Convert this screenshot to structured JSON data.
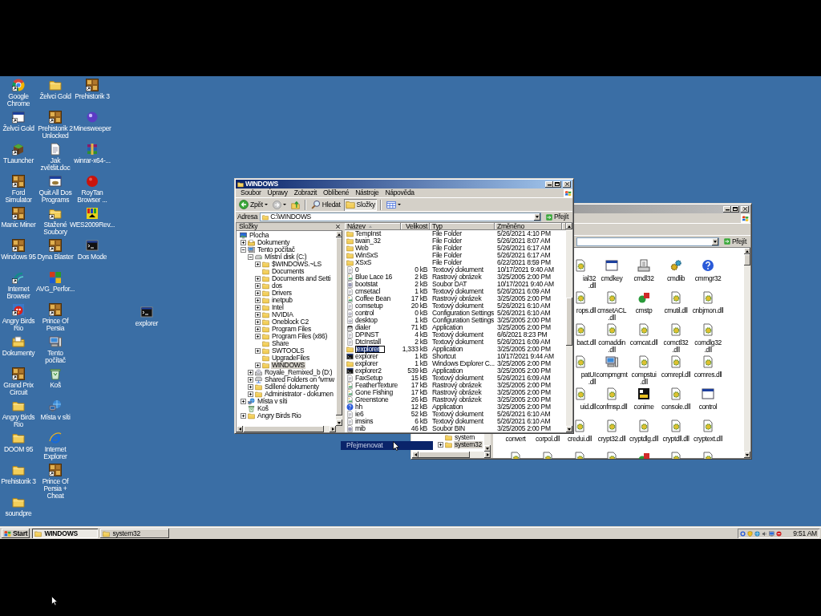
{
  "desktop": {
    "icon_rows": [
      [
        {
          "label": "Google Chrome",
          "kind": "chrome",
          "shortcut": true
        },
        {
          "label": "Želvci Gold",
          "kind": "folder",
          "shortcut": false
        },
        {
          "label": "Prehistorik 3",
          "kind": "tile",
          "shortcut": true
        }
      ],
      [
        {
          "label": "Želvci Gold",
          "kind": "window",
          "shortcut": true
        },
        {
          "label": "Prehistorik 2 Unlocked",
          "kind": "tile",
          "shortcut": true
        },
        {
          "label": "Minesweeper",
          "kind": "orb",
          "shortcut": false
        }
      ],
      [
        {
          "label": "TLauncher",
          "kind": "block",
          "shortcut": true
        },
        {
          "label": "Jak zvětšit.doc",
          "kind": "document",
          "shortcut": false
        },
        {
          "label": "winrar-x64-...",
          "kind": "books",
          "shortcut": false
        }
      ],
      [
        {
          "label": "Ford Simulator",
          "kind": "tile",
          "shortcut": true
        },
        {
          "label": "Quit All Dos Programs",
          "kind": "dos",
          "shortcut": false
        },
        {
          "label": "RoyTan Browser ...",
          "kind": "ball",
          "shortcut": false
        }
      ],
      [
        {
          "label": "Manic Miner",
          "kind": "tile",
          "shortcut": true
        },
        {
          "label": "Stažené Soubory",
          "kind": "folder",
          "shortcut": true
        },
        {
          "label": "WES2009Rev...",
          "kind": "grid",
          "shortcut": false
        }
      ],
      [
        {
          "label": "Windows 95",
          "kind": "tile",
          "shortcut": true
        },
        {
          "label": "Dyna Blaster",
          "kind": "tile",
          "shortcut": true
        },
        {
          "label": "Dos Mode",
          "kind": "console",
          "shortcut": false
        }
      ],
      [
        {
          "label": "Internet Browser",
          "kind": "swirl",
          "shortcut": true
        },
        {
          "label": "AVG_Perfor...",
          "kind": "squares",
          "shortcut": false
        }
      ],
      [
        {
          "label": "Angry Birds Rio",
          "kind": "bird",
          "shortcut": true
        },
        {
          "label": "Prince Of Persia",
          "kind": "tile",
          "shortcut": true
        }
      ],
      [
        {
          "label": "Dokumenty",
          "kind": "docfolder",
          "shortcut": false
        },
        {
          "label": "Tento počítač",
          "kind": "computer",
          "shortcut": false
        }
      ],
      [
        {
          "label": "Grand Prix Circuit",
          "kind": "tile",
          "shortcut": true
        },
        {
          "label": "Koš",
          "kind": "recycle",
          "shortcut": false
        }
      ],
      [
        {
          "label": "Angry Birds Rio",
          "kind": "folder",
          "shortcut": false
        },
        {
          "label": "Místa v síti",
          "kind": "network",
          "shortcut": false
        }
      ],
      [
        {
          "label": "DOOM 95",
          "kind": "folder",
          "shortcut": false
        },
        {
          "label": "Internet Explorer",
          "kind": "ie",
          "shortcut": false
        }
      ],
      [
        {
          "label": "Prehistorik 3",
          "kind": "folder",
          "shortcut": false
        },
        {
          "label": "Prince Of Persia + Cheat",
          "kind": "tile",
          "shortcut": true
        }
      ],
      [
        {
          "label": "soundpre",
          "kind": "folder",
          "shortcut": false
        }
      ]
    ],
    "loose_icon": {
      "label": "explorer",
      "kind": "console",
      "shortcut": false
    }
  },
  "back_window": {
    "tree": [
      {
        "label": "system",
        "kind": "folder",
        "selected": false
      },
      {
        "label": "system32",
        "kind": "folder",
        "expanded": false,
        "selected": true
      }
    ],
    "go": "Přejít",
    "icon_rows": [
      [
        {
          "label": "ial32.dll",
          "kind": "dll"
        },
        {
          "label": "cmdkey",
          "kind": "window"
        },
        {
          "label": "cmdl32",
          "kind": "setup"
        },
        {
          "label": "cmdlib",
          "kind": "gears"
        },
        {
          "label": "cmmgr32",
          "kind": "help"
        }
      ],
      [
        {
          "label": "rops.dll",
          "kind": "dll"
        },
        {
          "label": "cmsetACL.dll",
          "kind": "dll"
        },
        {
          "label": "cmstp",
          "kind": "shapes"
        },
        {
          "label": "cmutil.dll",
          "kind": "dll"
        },
        {
          "label": "cnbjmon.dll",
          "kind": "dll"
        }
      ],
      [
        {
          "label": "bact.dll",
          "kind": "dll"
        },
        {
          "label": "comaddin.dll",
          "kind": "dll"
        },
        {
          "label": "comcat.dll",
          "kind": "dll"
        },
        {
          "label": "comctl32.dll",
          "kind": "dll"
        },
        {
          "label": "comdlg32.dll",
          "kind": "dll"
        }
      ],
      [
        {
          "label": "patUI.dll",
          "kind": "dll"
        },
        {
          "label": "compmgmt",
          "kind": "computer"
        },
        {
          "label": "compstui.dll",
          "kind": "dll"
        },
        {
          "label": "comrepl.dll",
          "kind": "dll"
        },
        {
          "label": "comres.dll",
          "kind": "dll"
        }
      ],
      [
        {
          "label": "uid.dll",
          "kind": "dll"
        },
        {
          "label": "confmsp.dll",
          "kind": "dll"
        },
        {
          "label": "conime",
          "kind": "ime"
        },
        {
          "label": "console.dll",
          "kind": "dll"
        },
        {
          "label": "control",
          "kind": "window"
        }
      ],
      [
        {
          "label": "convert"
        },
        {
          "label": "corpol.dll"
        },
        {
          "label": "credui.dll",
          "kind": "dll"
        },
        {
          "label": "crypt32.dll",
          "kind": "dll"
        },
        {
          "label": "cryptdlg.dll",
          "kind": "dll"
        },
        {
          "label": "cryptdll.dll",
          "kind": "dll"
        },
        {
          "label": "cryptext.dll",
          "kind": "dll"
        }
      ],
      [
        {
          "kind": "dll"
        },
        {
          "kind": "dll"
        },
        {
          "kind": "dll"
        },
        {
          "kind": "dll"
        },
        {
          "kind": "shapes"
        },
        {
          "kind": "dll"
        },
        {
          "kind": "dll"
        }
      ]
    ]
  },
  "explorer_window": {
    "title": "WINDOWS",
    "menu": [
      "Soubor",
      "Úpravy",
      "Zobrazit",
      "Oblíbené",
      "Nástroje",
      "Nápověda"
    ],
    "toolbar": {
      "back": "Zpět",
      "search": "Hledat",
      "folders": {
        "label": "Složky",
        "selected": true
      }
    },
    "address": {
      "label": "Adresa",
      "value": "C:\\WINDOWS",
      "go": "Přejít"
    },
    "folders_pane": {
      "title": "Složky",
      "tree": [
        {
          "label": "Plocha",
          "kind": "desktop",
          "selected": false,
          "children": [
            {
              "label": "Dokumenty",
              "kind": "docfolder",
              "expanded": false,
              "selected": false
            },
            {
              "label": "Tento počítač",
              "kind": "computer",
              "expanded": true,
              "selected": false,
              "children": [
                {
                  "label": "Místní disk (C:)",
                  "kind": "drive",
                  "expanded": true,
                  "selected": false,
                  "children": [
                    {
                      "label": "$WINDOWS.~LS",
                      "kind": "folder",
                      "expanded": false,
                      "selected": false
                    },
                    {
                      "label": "Documents",
                      "kind": "folder",
                      "selected": false
                    },
                    {
                      "label": "Documents and Setti",
                      "kind": "folder",
                      "expanded": false,
                      "selected": false
                    },
                    {
                      "label": "dos",
                      "kind": "folder",
                      "expanded": false,
                      "selected": false
                    },
                    {
                      "label": "Drivers",
                      "kind": "folder",
                      "expanded": false,
                      "selected": false
                    },
                    {
                      "label": "inetpub",
                      "kind": "folder",
                      "expanded": false,
                      "selected": false
                    },
                    {
                      "label": "Intel",
                      "kind": "folder",
                      "expanded": false,
                      "selected": false
                    },
                    {
                      "label": "NVIDIA",
                      "kind": "folder",
                      "expanded": false,
                      "selected": false
                    },
                    {
                      "label": "Oneblock C2",
                      "kind": "folder",
                      "expanded": false,
                      "selected": false
                    },
                    {
                      "label": "Program Files",
                      "kind": "folder",
                      "expanded": false,
                      "selected": false
                    },
                    {
                      "label": "Program Files (x86)",
                      "kind": "folder",
                      "expanded": false,
                      "selected": false
                    },
                    {
                      "label": "Share",
                      "kind": "folder",
                      "selected": false
                    },
                    {
                      "label": "SWTOOLS",
                      "kind": "folder",
                      "expanded": false,
                      "selected": false
                    },
                    {
                      "label": "UpgradeFiles",
                      "kind": "folder",
                      "selected": false
                    },
                    {
                      "label": "WINDOWS",
                      "kind": "folder",
                      "expanded": false,
                      "selected": true
                    }
                  ]
                },
                {
                  "label": "Royale_Remixed_b (D:)",
                  "kind": "cd",
                  "expanded": false,
                  "selected": false
                },
                {
                  "label": "Shared Folders on '\\vmw",
                  "kind": "share",
                  "expanded": false,
                  "selected": false
                },
                {
                  "label": "Sdílené dokumenty",
                  "kind": "folder",
                  "expanded": false,
                  "selected": false
                },
                {
                  "label": "Administrator - dokumen",
                  "kind": "folder",
                  "expanded": false,
                  "selected": false
                }
              ]
            },
            {
              "label": "Místa v síti",
              "kind": "network",
              "expanded": false,
              "selected": false
            },
            {
              "label": "Koš",
              "kind": "recycle",
              "selected": false
            },
            {
              "label": "Angry Birds Rio",
              "kind": "folder",
              "expanded": false,
              "selected": false
            }
          ]
        }
      ]
    },
    "file_list": {
      "columns": [
        "Název",
        "Velikost",
        "Typ",
        "Změněno"
      ],
      "rows": [
        {
          "name": "TempInst",
          "type": "File Folder",
          "modified": "5/26/2021 4:10 PM",
          "kind": "folder",
          "renaming": false
        },
        {
          "name": "twain_32",
          "type": "File Folder",
          "modified": "5/26/2021 8:07 AM",
          "kind": "folder",
          "renaming": false
        },
        {
          "name": "Web",
          "type": "File Folder",
          "modified": "5/26/2021 6:17 AM",
          "kind": "folder",
          "renaming": false
        },
        {
          "name": "WinSxS",
          "type": "File Folder",
          "modified": "5/26/2021 6:17 AM",
          "kind": "folder",
          "renaming": false
        },
        {
          "name": "XSxS",
          "type": "File Folder",
          "modified": "6/22/2021 8:59 PM",
          "kind": "folder",
          "renaming": false
        },
        {
          "name": "0",
          "size": "0 kB",
          "type": "Textový dokument",
          "modified": "10/17/2021 9:40 AM",
          "kind": "text",
          "renaming": false
        },
        {
          "name": "Blue Lace 16",
          "size": "2 kB",
          "type": "Rastrový obrázek",
          "modified": "3/25/2005 2:00 PM",
          "kind": "image",
          "renaming": false
        },
        {
          "name": "bootstat",
          "size": "2 kB",
          "type": "Soubor DAT",
          "modified": "10/17/2021 9:40 AM",
          "kind": "data",
          "renaming": false
        },
        {
          "name": "cmsetacl",
          "size": "1 kB",
          "type": "Textový dokument",
          "modified": "5/26/2021 6:09 AM",
          "kind": "text",
          "renaming": false
        },
        {
          "name": "Coffee Bean",
          "size": "17 kB",
          "type": "Rastrový obrázek",
          "modified": "3/25/2005 2:00 PM",
          "kind": "image",
          "renaming": false
        },
        {
          "name": "comsetup",
          "size": "20 kB",
          "type": "Textový dokument",
          "modified": "5/26/2021 6:10 AM",
          "kind": "text",
          "renaming": false
        },
        {
          "name": "control",
          "size": "0 kB",
          "type": "Configuration Settings",
          "modified": "5/26/2021 6:10 AM",
          "kind": "settings",
          "renaming": false
        },
        {
          "name": "desktop",
          "size": "1 kB",
          "type": "Configuration Settings",
          "modified": "3/25/2005 2:00 PM",
          "kind": "settings",
          "renaming": false
        },
        {
          "name": "dialer",
          "size": "71 kB",
          "type": "Application",
          "modified": "3/25/2005 2:00 PM",
          "kind": "phone",
          "renaming": false
        },
        {
          "name": "DPINST",
          "size": "4 kB",
          "type": "Textový dokument",
          "modified": "6/6/2021 8:23 PM",
          "kind": "text",
          "renaming": false
        },
        {
          "name": "DtcInstall",
          "size": "2 kB",
          "type": "Textový dokument",
          "modified": "5/26/2021 6:09 AM",
          "kind": "text",
          "renaming": false
        },
        {
          "name": "explorer",
          "size": "1,333 kB",
          "type": "Application",
          "modified": "3/25/2005 2:00 PM",
          "kind": "folder",
          "renaming": true
        },
        {
          "name": "explorer",
          "size": "1 kB",
          "type": "Shortcut",
          "modified": "10/17/2021 9:44 AM",
          "kind": "console",
          "renaming": false
        },
        {
          "name": "explorer",
          "size": "1 kB",
          "type": "Windows Explorer C...",
          "modified": "3/25/2005 2:00 PM",
          "kind": "folder",
          "renaming": false
        },
        {
          "name": "explorer2",
          "size": "539 kB",
          "type": "Application",
          "modified": "3/25/2005 2:00 PM",
          "kind": "console",
          "renaming": false
        },
        {
          "name": "FaxSetup",
          "size": "15 kB",
          "type": "Textový dokument",
          "modified": "5/26/2021 6:09 AM",
          "kind": "text",
          "renaming": false
        },
        {
          "name": "FeatherTexture",
          "size": "17 kB",
          "type": "Rastrový obrázek",
          "modified": "3/25/2005 2:00 PM",
          "kind": "image",
          "renaming": false
        },
        {
          "name": "Gone Fishing",
          "size": "17 kB",
          "type": "Rastrový obrázek",
          "modified": "3/25/2005 2:00 PM",
          "kind": "image",
          "renaming": false
        },
        {
          "name": "Greenstone",
          "size": "26 kB",
          "type": "Rastrový obrázek",
          "modified": "3/25/2005 2:00 PM",
          "kind": "image",
          "renaming": false
        },
        {
          "name": "hh",
          "size": "12 kB",
          "type": "Application",
          "modified": "3/25/2005 2:00 PM",
          "kind": "help",
          "renaming": false
        },
        {
          "name": "ie6",
          "size": "52 kB",
          "type": "Textový dokument",
          "modified": "5/26/2021 6:10 AM",
          "kind": "text",
          "renaming": false
        },
        {
          "name": "imsins",
          "size": "6 kB",
          "type": "Textový dokument",
          "modified": "5/26/2021 6:10 AM",
          "kind": "text",
          "renaming": false
        },
        {
          "name": "mib",
          "size": "46 kB",
          "type": "Soubor BIN",
          "modified": "3/25/2005 2:00 PM",
          "kind": "data",
          "renaming": false
        }
      ]
    }
  },
  "drag_label": {
    "text": "Přejmenovat"
  },
  "taskbar": {
    "start": "Start",
    "tasks": [
      {
        "label": "WINDOWS",
        "selected": true
      },
      {
        "label": "system32",
        "selected": false
      }
    ],
    "clock": "9:51 AM"
  }
}
